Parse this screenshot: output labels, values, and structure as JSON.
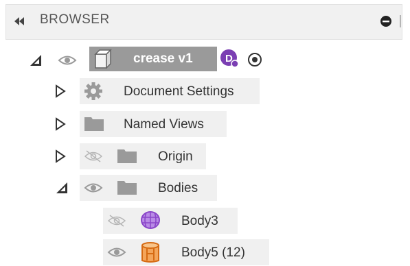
{
  "header": {
    "title": "BROWSER",
    "collapse_icon": "double-chevron-left-icon",
    "minimize_icon": "minus-circle-icon"
  },
  "tree": {
    "root": {
      "label": "crease v1",
      "expanded": true,
      "badge_letter": "D",
      "badge_color": "#7b3fb3",
      "icons": [
        "eye-icon",
        "component-box-icon",
        "radio-target-icon"
      ]
    },
    "items": [
      {
        "label": "Document Settings",
        "icon": "gear-icon",
        "expanded": false
      },
      {
        "label": "Named Views",
        "icon": "folder-icon",
        "expanded": false
      },
      {
        "label": "Origin",
        "icon": "folder-icon",
        "expanded": false,
        "visible": false
      },
      {
        "label": "Bodies",
        "icon": "folder-icon",
        "expanded": true,
        "visible": true
      }
    ],
    "bodies": [
      {
        "label": "Body3",
        "icon": "mesh-body-icon",
        "visible": false,
        "color": "#9b59d6"
      },
      {
        "label": "Body5 (12)",
        "icon": "solid-body-icon",
        "visible": true,
        "color": "#e8852e"
      }
    ]
  }
}
